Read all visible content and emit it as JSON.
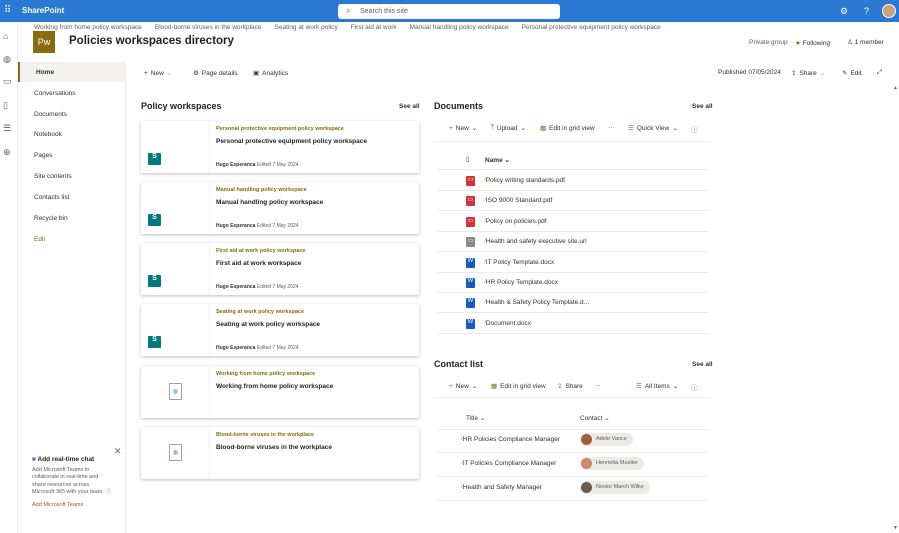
{
  "app": {
    "name": "SharePoint",
    "search_placeholder": "Search this site"
  },
  "hub_nav": [
    "Working from home policy workspace",
    "Blood-borne viruses in the workplace",
    "Seating at work policy",
    "First aid at work",
    "Manual handling policy workspace",
    "Personal protective equipment policy workspace"
  ],
  "site": {
    "logo": "Pw",
    "title": "Policies workspaces directory",
    "privacy": "Private group",
    "following": "Following",
    "members": "1 member"
  },
  "left_nav": [
    "Home",
    "Conversations",
    "Documents",
    "Notebook",
    "Pages",
    "Site contents",
    "Contacts list",
    "Recycle bin",
    "Edit"
  ],
  "command_bar": {
    "new": "New",
    "page_details": "Page details",
    "analytics": "Analytics",
    "published": "Published 07/05/2024",
    "share": "Share",
    "edit": "Edit"
  },
  "policy": {
    "heading": "Policy workspaces",
    "see_all": "See all",
    "cards": [
      {
        "category": "Personal protective equipment policy workspace",
        "title": "Personal protective equipment policy workspace",
        "author": "Hugo Esperanca",
        "edited": "Edited 7 May 2024",
        "icon": "sharepoint"
      },
      {
        "category": "Manual handling policy workspace",
        "title": "Manual handling policy workspace",
        "author": "Hugo Esperanca",
        "edited": "Edited 7 May 2024",
        "icon": "sharepoint"
      },
      {
        "category": "First aid at work policy workspace",
        "title": "First aid at work workspace",
        "author": "Hugo Esperanca",
        "edited": "Edited 7 May 2024",
        "icon": "sharepoint"
      },
      {
        "category": "Seating at work policy workspace",
        "title": "Seating at work policy workspace",
        "author": "Hugo Esperanca",
        "edited": "Edited 7 May 2024",
        "icon": "sharepoint"
      },
      {
        "category": "Working from home policy workspace",
        "title": "Working from home policy workspace",
        "icon": "page"
      },
      {
        "category": "Blood-borne viruses in the workplace",
        "title": "Blood-borne viruses in the workplace",
        "icon": "page"
      }
    ]
  },
  "documents": {
    "heading": "Documents",
    "see_all": "See all",
    "toolbar": {
      "new": "New",
      "upload": "Upload",
      "grid": "Edit in grid view",
      "more": "···",
      "view": "Quick View"
    },
    "col_name": "Name",
    "files": [
      {
        "name": "Policy writing standards.pdf",
        "type": "pdf"
      },
      {
        "name": "ISO 9000 Standard.pdf",
        "type": "pdf"
      },
      {
        "name": "Policy on policies.pdf",
        "type": "pdf"
      },
      {
        "name": "Health and safety executive site.url",
        "type": "url"
      },
      {
        "name": "IT Policy Template.docx",
        "type": "docx"
      },
      {
        "name": "HR Policy Template.docx",
        "type": "docx"
      },
      {
        "name": "Health & Safety Policy Template.d...",
        "type": "docx"
      },
      {
        "name": "Document.docx",
        "type": "docx"
      }
    ]
  },
  "contacts": {
    "heading": "Contact list",
    "see_all": "See all",
    "toolbar": {
      "new": "New",
      "grid": "Edit in grid view",
      "share": "Share",
      "more": "···",
      "view": "All Items"
    },
    "col_title": "Title",
    "col_contact": "Contact",
    "rows": [
      {
        "title": "HR Policies Compliance Manager",
        "contact": "Adele Vance"
      },
      {
        "title": "IT Policies Compliance Manager",
        "contact": "Henrietta Mueller"
      },
      {
        "title": "Health and Safety Manager",
        "contact": "Nestor March Wilke"
      }
    ]
  },
  "chat": {
    "title": "Add real-time chat",
    "body": "Add Microsoft Teams to collaborate in real-time and share resources across Microsoft 365 with your team.",
    "link": "Add Microsoft Teams"
  },
  "colors": {
    "topbar": "#2b79d3",
    "accent": "#8a6b0f"
  }
}
